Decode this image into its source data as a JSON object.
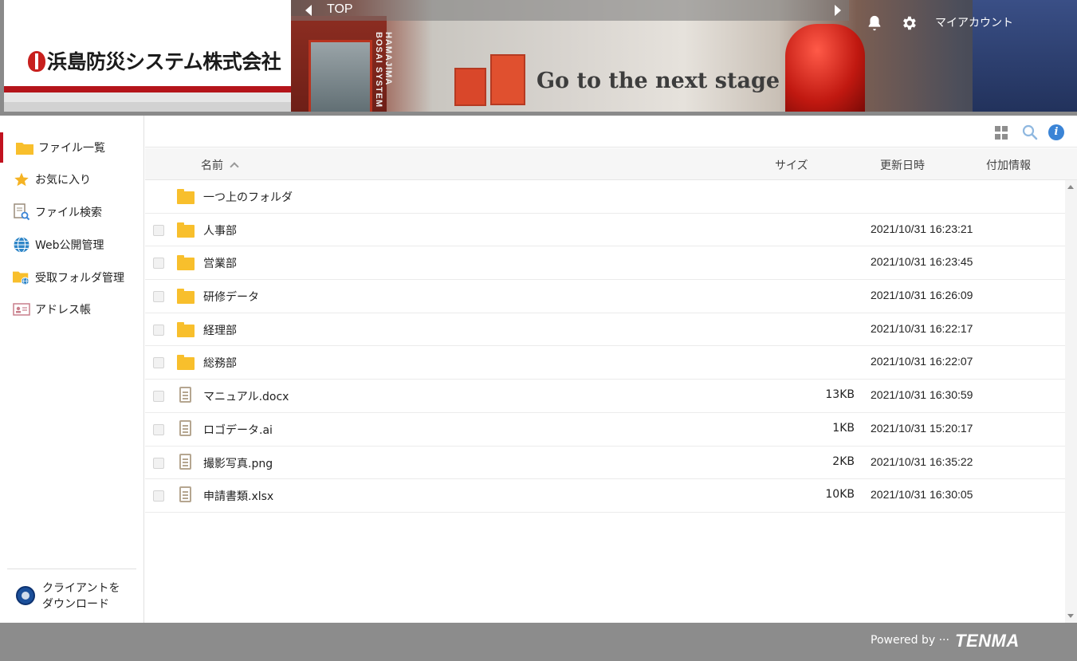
{
  "header": {
    "logo_text": "浜島防災システム株式会社",
    "banner_vertical_text": "HAMAJIMA BOSAI SYSTEM",
    "banner_slogan": "Go to the next stage",
    "breadcrumb": "TOP",
    "account_label": "マイアカウント",
    "brand_color": "#b4141a"
  },
  "sidebar": {
    "items": [
      {
        "label": "ファイル一覧",
        "icon": "folder-icon",
        "active": true
      },
      {
        "label": "お気に入り",
        "icon": "star-icon"
      },
      {
        "label": "ファイル検索",
        "icon": "file-search-icon"
      },
      {
        "label": "Web公開管理",
        "icon": "globe-icon"
      },
      {
        "label": "受取フォルダ管理",
        "icon": "folder-globe-icon"
      },
      {
        "label": "アドレス帳",
        "icon": "address-card-icon"
      }
    ],
    "client_download_line1": "クライアントを",
    "client_download_line2": "ダウンロード"
  },
  "table": {
    "headers": {
      "name": "名前",
      "size": "サイズ",
      "modified": "更新日時",
      "extra": "付加情報"
    },
    "parent_folder": "一つ上のフォルダ",
    "rows": [
      {
        "type": "folder",
        "name": "人事部",
        "size": "",
        "date": "2021/10/31 16:23:21"
      },
      {
        "type": "folder",
        "name": "営業部",
        "size": "",
        "date": "2021/10/31 16:23:45"
      },
      {
        "type": "folder",
        "name": "研修データ",
        "size": "",
        "date": "2021/10/31 16:26:09"
      },
      {
        "type": "folder",
        "name": "経理部",
        "size": "",
        "date": "2021/10/31 16:22:17"
      },
      {
        "type": "folder",
        "name": "総務部",
        "size": "",
        "date": "2021/10/31 16:22:07"
      },
      {
        "type": "file",
        "name": "マニュアル.docx",
        "size": "13KB",
        "date": "2021/10/31 16:30:59"
      },
      {
        "type": "file",
        "name": "ロゴデータ.ai",
        "size": "1KB",
        "date": "2021/10/31 15:20:17"
      },
      {
        "type": "file",
        "name": "撮影写真.png",
        "size": "2KB",
        "date": "2021/10/31 16:35:22"
      },
      {
        "type": "file",
        "name": "申請書類.xlsx",
        "size": "10KB",
        "date": "2021/10/31 16:30:05"
      }
    ]
  },
  "footer": {
    "powered_by": "Powered by ···",
    "brand": "TENMA"
  }
}
